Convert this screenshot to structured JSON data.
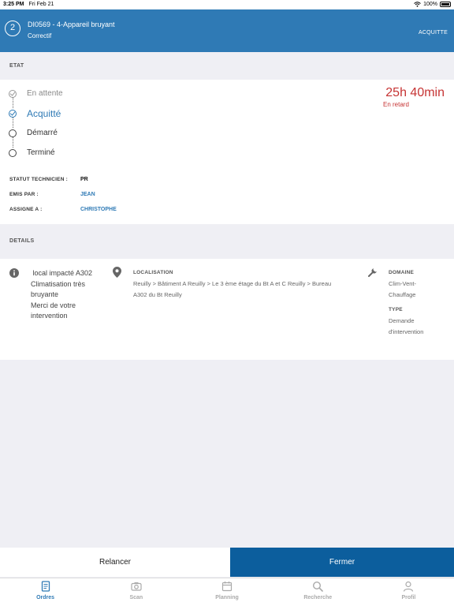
{
  "status_bar": {
    "time": "3:25 PM",
    "date": "Fri Feb 21",
    "battery": "100%"
  },
  "header": {
    "step": "2",
    "title": "DI0569 - 4-Appareil bruyant",
    "subtitle": "Correctif",
    "action": "ACQUITTE"
  },
  "etat": {
    "section_label": "ETAT",
    "steps": [
      {
        "label": "En attente"
      },
      {
        "label": "Acquitté"
      },
      {
        "label": "Démarré"
      },
      {
        "label": "Terminé"
      }
    ],
    "late_time": "25h 40min",
    "late_label": "En retard",
    "statut_label": "STATUT TECHNICIEN :",
    "statut_value": "PR",
    "emis_label": "EMIS PAR :",
    "emis_value": "JEAN",
    "assigne_label": "ASSIGNE A :",
    "assigne_value": "CHRISTOPHE"
  },
  "details": {
    "section_label": "DETAILS",
    "description_lines": [
      " local impacté A302",
      "Climatisation très",
      "bruyante",
      "Merci de votre",
      "intervention"
    ],
    "localisation_label": "LOCALISATION",
    "localisation_lines": [
      "Reuilly > Bâtiment A Reuilly > Le 3 ème étage du Bt A et C Reuilly > Bureau",
      "A302 du Bt Reuilly"
    ],
    "domaine_label": "DOMAINE",
    "domaine_lines": [
      "Clim-Vent-",
      "Chauffage"
    ],
    "type_label": "TYPE",
    "type_lines": [
      "Demande",
      "d'intervention"
    ]
  },
  "actions": {
    "relancer": "Relancer",
    "fermer": "Fermer"
  },
  "tabs": [
    {
      "label": "Ordres",
      "icon": "document-icon"
    },
    {
      "label": "Scan",
      "icon": "camera-icon"
    },
    {
      "label": "Planning",
      "icon": "calendar-icon"
    },
    {
      "label": "Recherche",
      "icon": "search-icon"
    },
    {
      "label": "Profil",
      "icon": "person-icon"
    }
  ],
  "colors": {
    "header": "#2f7ab5",
    "primary_button": "#0c5e9d",
    "late": "#c63434"
  }
}
